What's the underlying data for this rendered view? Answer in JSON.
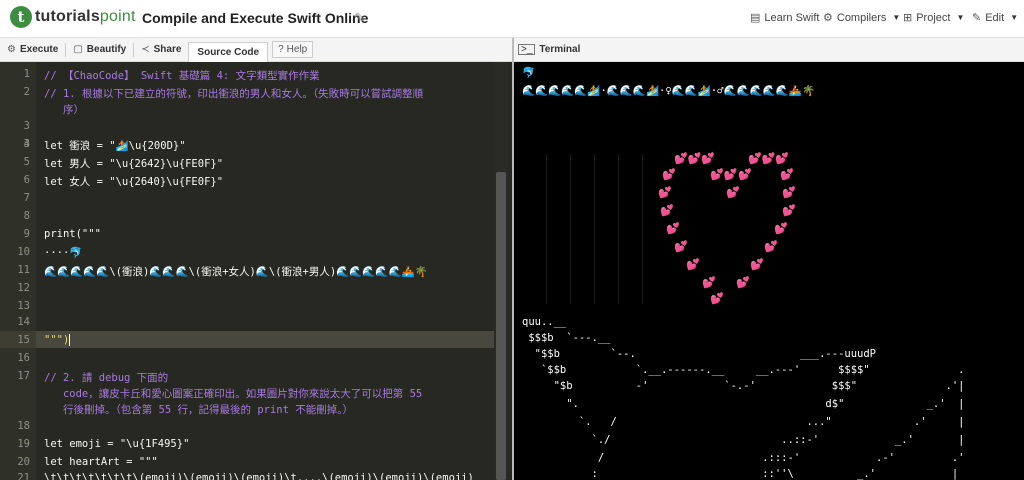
{
  "header": {
    "logo_mark": "t",
    "logo_bold": "tutorials",
    "logo_light": "point",
    "title": "Compile and Execute Swift Online",
    "nav": [
      {
        "label": "Learn Swift"
      },
      {
        "label": "Compilers"
      },
      {
        "label": "Project"
      },
      {
        "label": "Edit"
      }
    ]
  },
  "toolbar": {
    "execute": "Execute",
    "beautify": "Beautify",
    "share": "Share",
    "source_code": "Source Code",
    "help": "Help"
  },
  "terminal": {
    "title": "Terminal",
    "lines": [
      "🐬",
      "🌊🌊🌊🌊🌊🏄·🌊🌊🌊🏄·♀🌊🌊🏄·♂🌊🌊🌊🌊🌊🚣🌴",
      "quu..__",
      " $$$b  `---.__",
      "  \"$$b        `--.                          ___.---uuudP",
      "   `$$b           `.__.------.__     __.---'      $$$$\"              .",
      "     \"$b          -'            `-.-'            $$$\"              .'|",
      "       \".                                       d$\"             _.'  |",
      "         `.   /                              ...\"             .'     |",
      "           `./                           ..::-'            _.'       |",
      "            /                         .:::-'            .-'         .'",
      "           :                          ::''\\          _.'            |"
    ]
  },
  "editor": {
    "lines": [
      {
        "n": "1",
        "text": "// 【ChaoCode】 Swift 基礎篇 4: 文字類型實作作業"
      },
      {
        "n": "2",
        "text": "// 1. 根據以下已建立的符號，印出衝浪的男人和女人。（失敗時可以嘗試調整順"
      },
      {
        "n": "",
        "text": "   序）"
      },
      {
        "n": "3",
        "text": ""
      },
      {
        "n": "4",
        "text": "let 衝浪 = \"🏄\\u{200D}\""
      },
      {
        "n": "5",
        "text": "let 男人 = \"\\u{2642}\\u{FE0F}\""
      },
      {
        "n": "6",
        "text": "let 女人 = \"\\u{2640}\\u{FE0F}\""
      },
      {
        "n": "7",
        "text": ""
      },
      {
        "n": "8",
        "text": ""
      },
      {
        "n": "9",
        "text": "print(\"\"\""
      },
      {
        "n": "10",
        "text": "····🐬"
      },
      {
        "n": "11",
        "text": "🌊🌊🌊🌊🌊\\(衝浪)🌊🌊🌊\\(衝浪+女人)🌊\\(衝浪+男人)🌊🌊🌊🌊🌊🚣🌴"
      },
      {
        "n": "12",
        "text": ""
      },
      {
        "n": "13",
        "text": ""
      },
      {
        "n": "14",
        "text": ""
      },
      {
        "n": "15",
        "text": "\"\"\")"
      },
      {
        "n": "16",
        "text": ""
      },
      {
        "n": "17",
        "text": "// 2. 請 debug 下面的"
      },
      {
        "n": "",
        "text": "   code，讓皮卡丘和愛心圖案正確印出。如果圖片對你來說太大了可以把第 55"
      },
      {
        "n": "",
        "text": "   行後刪掉。（包含第 55 行，記得最後的 print 不能刪掉。）"
      },
      {
        "n": "18",
        "text": ""
      },
      {
        "n": "19",
        "text": "let emoji = \"\\u{1F495}\""
      },
      {
        "n": "20",
        "text": "let heartArt = \"\"\""
      },
      {
        "n": "21",
        "text": "\\t\\t\\t\\t\\t\\t\\t\\(emoji)\\(emoji)\\(emoji)\\t....\\(emoji)\\(emoji)\\(emoji)"
      }
    ]
  }
}
